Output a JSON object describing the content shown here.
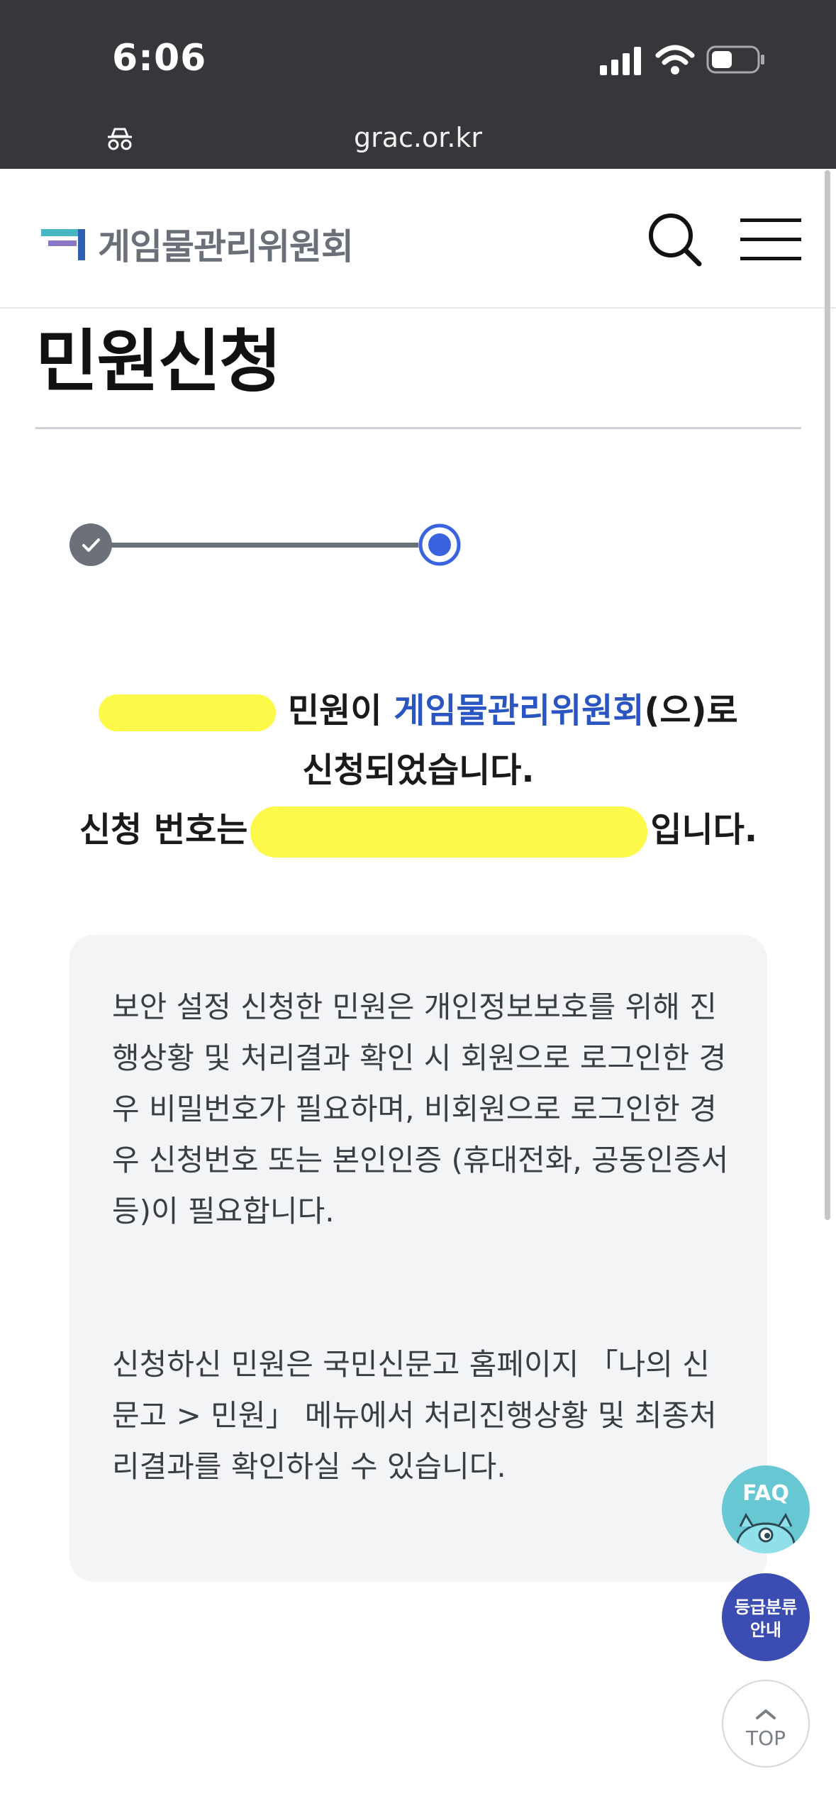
{
  "status_bar": {
    "time": "6:06",
    "url": "grac.or.kr"
  },
  "header": {
    "logo_text": "게임물관리위원회"
  },
  "page": {
    "title": "민원신청"
  },
  "stepper": {
    "steps_total": 2,
    "current_step": 2
  },
  "result": {
    "line1_suffix": " 민원이 ",
    "org_name": "게임물관리위원회",
    "line1_end": "(으)로",
    "line2": "신청되었습니다.",
    "line3_prefix": "신청 번호는",
    "line3_suffix": "입니다."
  },
  "info": {
    "para1": "보안 설정 신청한 민원은 개인정보보호를 위해 진행상황 및 처리결과 확인 시 회원으로 로그인한 경우 비밀번호가 필요하며, 비회원으로 로그인한 경우 신청번호 또는 본인인증 (휴대전화, 공동인증서 등)이 필요합니다.",
    "para2": "신청하신 민원은 국민신문고 홈페이지 「나의 신문고 > 민원」 메뉴에서 처리진행상황 및 최종처리결과를 확인하실 수 있습니다."
  },
  "floating": {
    "faq_label": "FAQ",
    "grade_label_1": "등급분류",
    "grade_label_2": "안내",
    "top_label": "TOP"
  },
  "colors": {
    "status_bar_bg": "#36373a",
    "accent_blue": "#2b56c2",
    "redaction": "#fdf94a",
    "faq_bg": "#67c7d3",
    "grade_bg": "#3b4db2"
  }
}
